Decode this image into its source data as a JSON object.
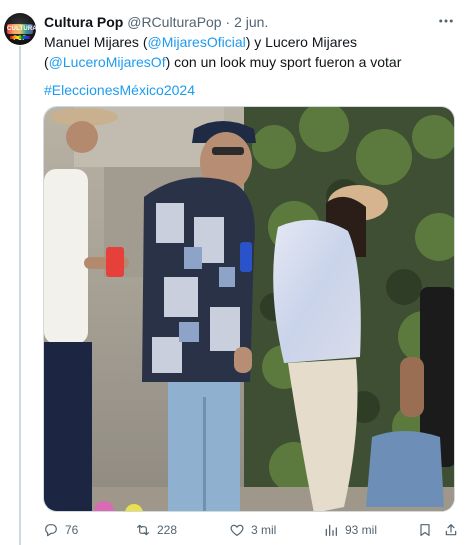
{
  "tweet": {
    "display_name": "Cultura Pop",
    "handle": "@RCulturaPop",
    "separator": " · ",
    "date": "2 jun.",
    "text_parts": {
      "p1": "Manuel Mijares (",
      "mention1": "@MijaresOficial",
      "p2": ") y Lucero Mijares (",
      "mention2": "@LuceroMijaresOf",
      "p3": ") con un look muy sport fueron a votar"
    },
    "hashtag": "#EleccionesMéxico2024",
    "avatar_logo_text": "CULTURA POP"
  },
  "metrics": {
    "replies": "76",
    "reposts": "228",
    "likes": "3 mil",
    "views": "93 mil"
  },
  "icons": {
    "reply": "reply-icon",
    "repost": "repost-icon",
    "like": "heart-icon",
    "views": "views-icon",
    "bookmark": "bookmark-icon",
    "share": "share-icon",
    "more": "more-icon"
  },
  "colors": {
    "link": "#1d9bf0",
    "secondary_text": "#536471",
    "repost_active": "#00ba7c"
  }
}
